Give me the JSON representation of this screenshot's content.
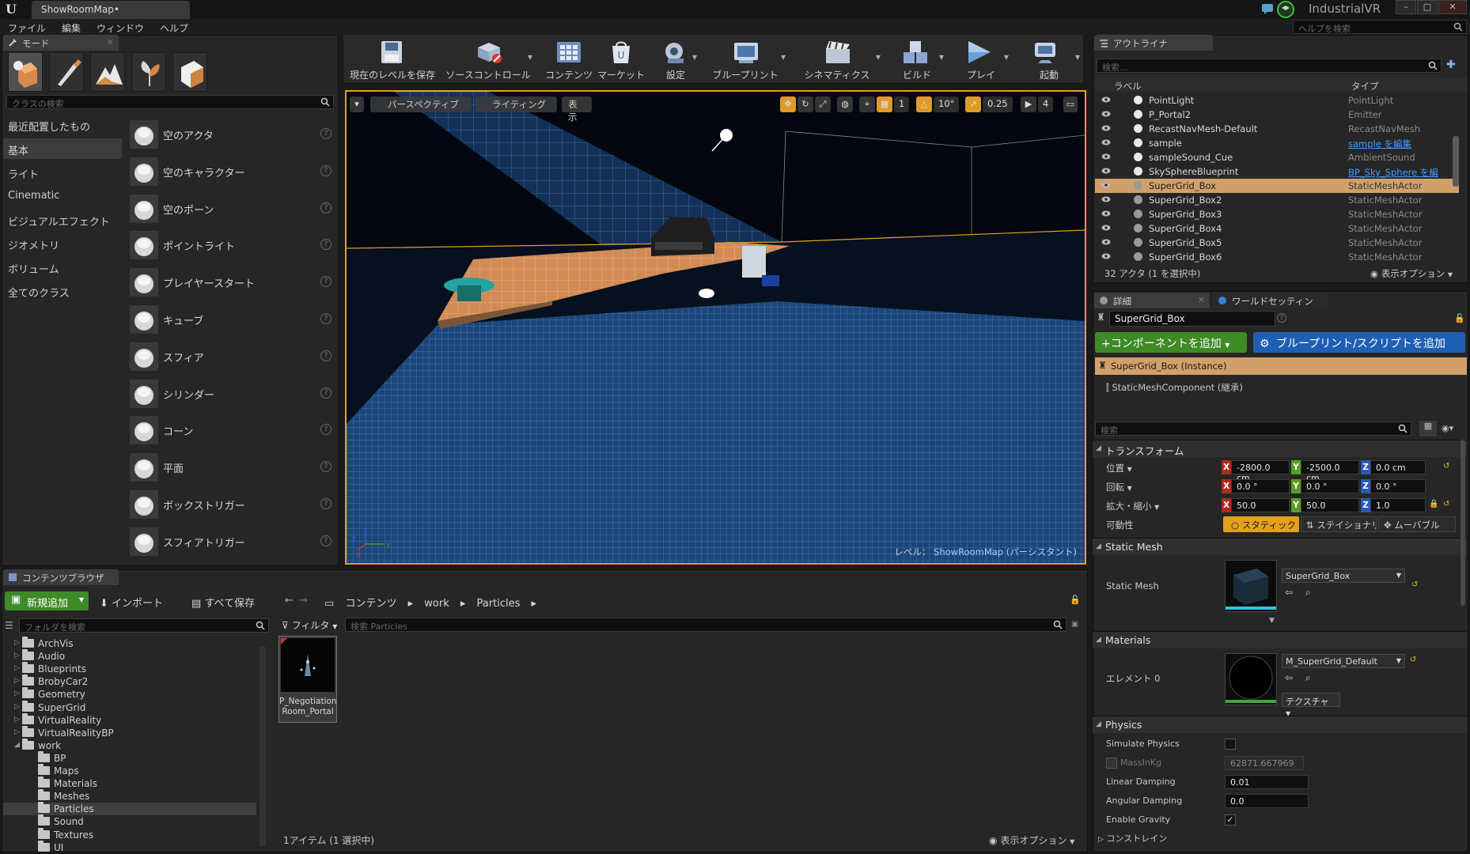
{
  "window": {
    "tab_title": "ShowRoomMap•",
    "project_name": "IndustrialVR",
    "help_search_placeholder": "ヘルプを検索",
    "min_glyph": "–",
    "max_glyph": "□",
    "close_glyph": "✕"
  },
  "menu": [
    "ファイル",
    "編集",
    "ウィンドウ",
    "ヘルプ"
  ],
  "modes": {
    "tab_label": "モード",
    "search_placeholder": "クラスの検索",
    "categories": [
      "最近配置したもの",
      "基本",
      "ライト",
      "Cinematic",
      "ビジュアルエフェクト",
      "ジオメトリ",
      "ボリューム",
      "全てのクラス"
    ],
    "selected_category": "基本",
    "actors": [
      "空のアクタ",
      "空のキャラクター",
      "空のポーン",
      "ポイントライト",
      "プレイヤースタート",
      "キューブ",
      "スフィア",
      "シリンダー",
      "コーン",
      "平面",
      "ボックストリガー",
      "スフィアトリガー"
    ],
    "help_glyph": "?"
  },
  "toolbar": {
    "items": [
      {
        "label": "現在のレベルを保存",
        "icon": "save-icon"
      },
      {
        "label": "ソースコントロール",
        "icon": "source-control-icon"
      },
      {
        "label": "コンテンツ",
        "icon": "content-icon"
      },
      {
        "label": "マーケット",
        "icon": "marketplace-icon"
      },
      {
        "label": "設定",
        "icon": "settings-icon"
      },
      {
        "label": "ブループリント",
        "icon": "blueprint-icon"
      },
      {
        "label": "シネマティクス",
        "icon": "cinematics-icon"
      },
      {
        "label": "ビルド",
        "icon": "build-icon"
      },
      {
        "label": "プレイ",
        "icon": "play-icon"
      },
      {
        "label": "起動",
        "icon": "launch-icon"
      }
    ]
  },
  "viewport": {
    "menu_glyph": "▾",
    "perspective_label": "パースペクティブ",
    "lighting_label": "ライティング",
    "show_label": "表示",
    "grid_snap_value": "1",
    "rotation_snap_value": "10°",
    "scale_snap_value": "0.25",
    "camera_speed_value": "4",
    "level_prefix": "レベル：",
    "level_name": "ShowRoomMap (パーシスタント)",
    "axis_x": "X",
    "axis_y": "Y",
    "axis_z": "Z",
    "colors": {
      "border_selected": "#e3a01c",
      "grid_blue": "#1f4a85",
      "platform": "#d8945a"
    }
  },
  "outliner": {
    "tab_label": "アウトライナ",
    "search_placeholder": "検索...",
    "col_label": "ラベル",
    "col_type": "タイプ",
    "rows": [
      {
        "label": "PointLight",
        "type": "PointLight",
        "link": false
      },
      {
        "label": "P_Portal2",
        "type": "Emitter",
        "link": false
      },
      {
        "label": "RecastNavMesh-Default",
        "type": "RecastNavMesh",
        "link": false
      },
      {
        "label": "sample",
        "type": "sample を編集",
        "link": true
      },
      {
        "label": "sampleSound_Cue",
        "type": "AmbientSound",
        "link": false
      },
      {
        "label": "SkySphereBlueprint",
        "type": "BP_Sky_Sphere を編",
        "link": true
      },
      {
        "label": "SuperGrid_Box",
        "type": "StaticMeshActor",
        "link": false
      },
      {
        "label": "SuperGrid_Box2",
        "type": "StaticMeshActor",
        "link": false
      },
      {
        "label": "SuperGrid_Box3",
        "type": "StaticMeshActor",
        "link": false
      },
      {
        "label": "SuperGrid_Box4",
        "type": "StaticMeshActor",
        "link": false
      },
      {
        "label": "SuperGrid_Box5",
        "type": "StaticMeshActor",
        "link": false
      },
      {
        "label": "SuperGrid_Box6",
        "type": "StaticMeshActor",
        "link": false
      }
    ],
    "selected_index": 6,
    "status": "32 アクタ (1 を選択中)",
    "view_options": "表示オプション"
  },
  "details": {
    "tab_label": "詳細",
    "world_tab_label": "ワールドセッティン",
    "actor_name": "SuperGrid_Box",
    "add_component": "+コンポーネントを追加",
    "blueprint_button": "ブループリント/スクリプトを追加",
    "instance_label": "SuperGrid_Box (Instance)",
    "component_label": "StaticMeshComponent (継承)",
    "search_placeholder": "検索",
    "transform": {
      "section": "トランスフォーム",
      "location_label": "位置",
      "rotation_label": "回転",
      "scale_label": "拡大・縮小",
      "mobility_label": "可動性",
      "location": [
        "-2800.0 cm",
        "-2500.0 cm",
        "0.0 cm"
      ],
      "rotation": [
        "0.0 °",
        "0.0 °",
        "0.0 °"
      ],
      "scale": [
        "50.0",
        "50.0",
        "1.0"
      ],
      "mobility": [
        "スタティック",
        "ステイショナリ",
        "ムーバブル"
      ]
    },
    "static_mesh": {
      "section": "Static Mesh",
      "label": "Static Mesh",
      "value": "SuperGrid_Box"
    },
    "materials": {
      "section": "Materials",
      "element_label": "エレメント 0",
      "value": "M_SuperGrid_Default",
      "texture_label": "テクスチャ"
    },
    "physics": {
      "section": "Physics",
      "simulate": "Simulate Physics",
      "mass_label": "MassInKg",
      "mass_value": "62871.667969",
      "linear_label": "Linear Damping",
      "linear_value": "0.01",
      "angular_label": "Angular Damping",
      "angular_value": "0.0",
      "gravity_label": "Enable Gravity",
      "constraints_label": "コンストレイン"
    }
  },
  "content_browser": {
    "tab_label": "コンテンツブラウザ",
    "add_new": "新規追加",
    "import": "インポート",
    "save_all": "すべて保存",
    "path": [
      "コンテンツ",
      "work",
      "Particles"
    ],
    "folder_search_placeholder": "フォルダを検索",
    "filter_label": "フィルタ",
    "asset_search_placeholder": "検索 Particles",
    "folders": [
      {
        "name": "ArchVis",
        "level": 0,
        "expanded": false
      },
      {
        "name": "Audio",
        "level": 0,
        "expanded": false
      },
      {
        "name": "Blueprints",
        "level": 0,
        "expanded": false
      },
      {
        "name": "BrobyCar2",
        "level": 0,
        "expanded": false
      },
      {
        "name": "Geometry",
        "level": 0,
        "expanded": false
      },
      {
        "name": "SuperGrid",
        "level": 0,
        "expanded": false
      },
      {
        "name": "VirtualReality",
        "level": 0,
        "expanded": false
      },
      {
        "name": "VirtualRealityBP",
        "level": 0,
        "expanded": false
      },
      {
        "name": "work",
        "level": 0,
        "expanded": true
      },
      {
        "name": "BP",
        "level": 1,
        "expanded": false
      },
      {
        "name": "Maps",
        "level": 1,
        "expanded": false
      },
      {
        "name": "Materials",
        "level": 1,
        "expanded": false
      },
      {
        "name": "Meshes",
        "level": 1,
        "expanded": false
      },
      {
        "name": "Particles",
        "level": 1,
        "expanded": false
      },
      {
        "name": "Sound",
        "level": 1,
        "expanded": false
      },
      {
        "name": "Textures",
        "level": 1,
        "expanded": false
      },
      {
        "name": "UI",
        "level": 1,
        "expanded": false
      }
    ],
    "selected_folder": "Particles",
    "asset_name": "P_Negotiation\nRoom_Portal",
    "status": "1アイテム (1 選択中)",
    "view_options": "表示オプション"
  }
}
